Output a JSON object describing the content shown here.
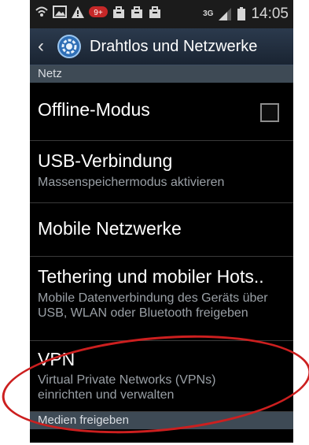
{
  "status_bar": {
    "time": "14:05",
    "network": "3G",
    "notif_badge": "9+"
  },
  "header": {
    "title": "Drahtlos und Netzwerke",
    "back_icon": "chevron-left-icon",
    "settings_icon": "gear-icon"
  },
  "sections": {
    "netz": "Netz",
    "medien": "Medien freigeben"
  },
  "items": [
    {
      "title": "Offline-Modus",
      "subtitle": "",
      "checked": false
    },
    {
      "title": "USB-Verbindung",
      "subtitle": "Massenspeichermodus aktivieren"
    },
    {
      "title": "Mobile Netzwerke",
      "subtitle": ""
    },
    {
      "title": "Tethering und mobiler Hots..",
      "subtitle": "Mobile Datenverbindung des Geräts über USB, WLAN oder Bluetooth freigeben"
    },
    {
      "title": "VPN",
      "subtitle": "Virtual Private Networks (VPNs) einrichten und verwalten"
    }
  ],
  "colors": {
    "header_bg": "#2b3a4d",
    "section_bg": "#3e4a55",
    "highlight_circle": "#cc1f1f"
  }
}
